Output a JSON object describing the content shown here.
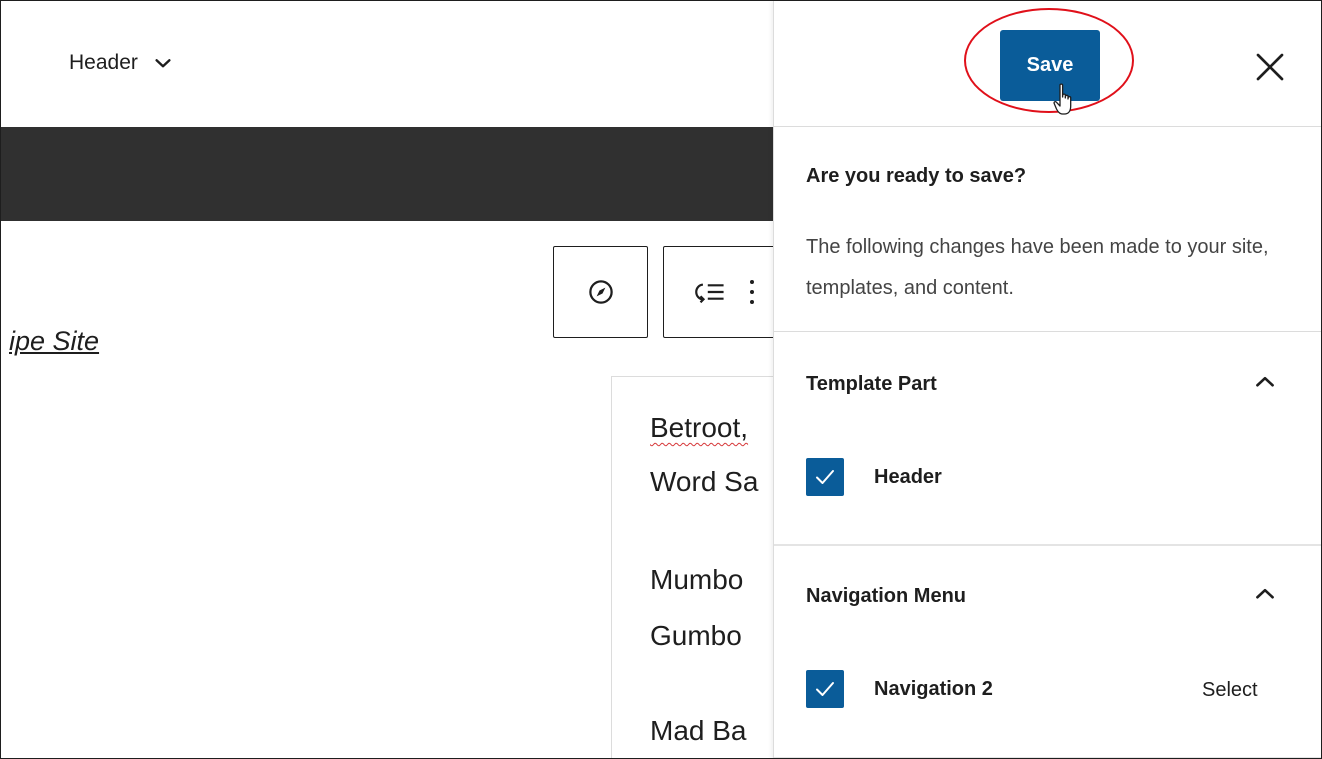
{
  "editor": {
    "doc_title": "Header",
    "site_title": "ipe Site",
    "menu_items": [
      "Betroot,",
      "Word Sa",
      "Mumbo",
      "Gumbo",
      "Mad Ba"
    ]
  },
  "panel": {
    "save_label": "Save",
    "prompt": "Are you ready to save?",
    "description": "The following changes have been made to your site, templates, and content.",
    "sections": [
      {
        "title": "Template Part",
        "items": [
          {
            "label": "Header",
            "checked": true
          }
        ]
      },
      {
        "title": "Navigation Menu",
        "items": [
          {
            "label": "Navigation 2",
            "checked": true,
            "action": "Select"
          }
        ]
      }
    ]
  },
  "colors": {
    "accent": "#0a5c99",
    "dark_bar": "#303030",
    "highlight": "#e0101a"
  },
  "icons": [
    "chevron-down-icon",
    "compass-icon",
    "list-view-icon",
    "more-vertical-icon",
    "close-icon",
    "chevron-up-icon",
    "checkmark-icon",
    "hand-cursor-icon"
  ]
}
